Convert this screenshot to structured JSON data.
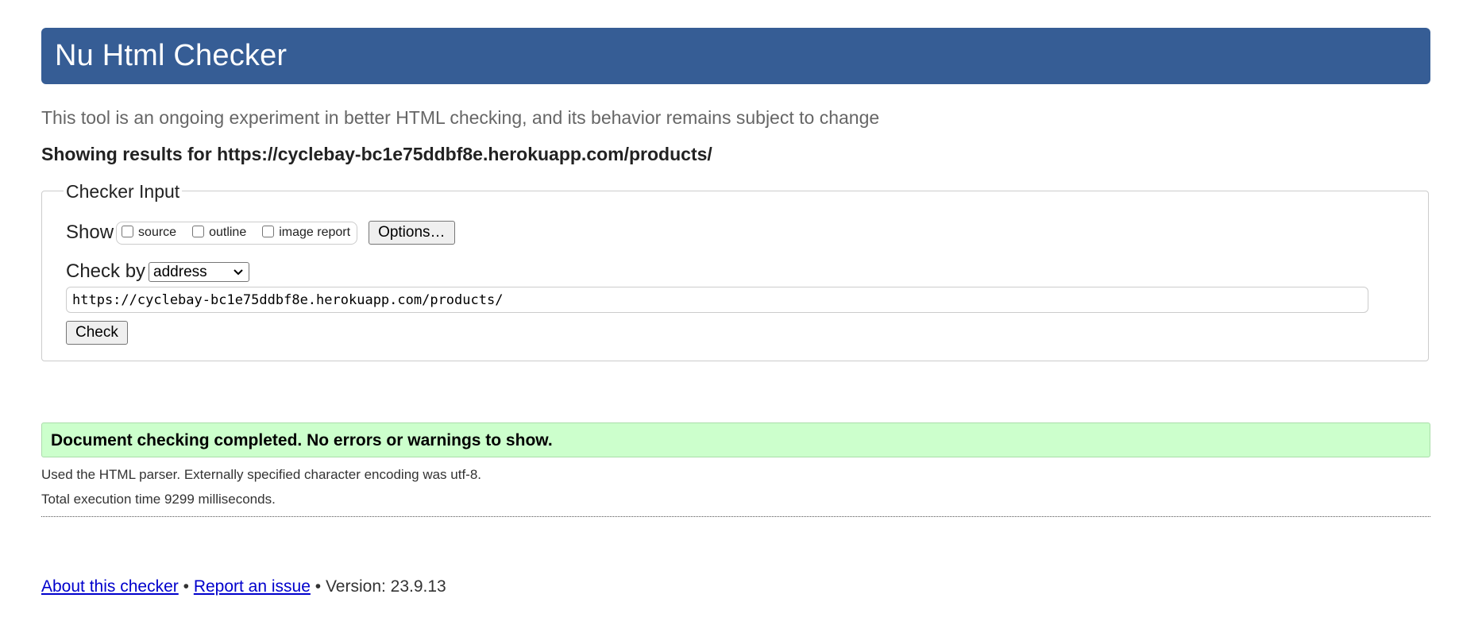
{
  "header": {
    "title": "Nu Html Checker"
  },
  "subtitle": "This tool is an ongoing experiment in better HTML checking, and its behavior remains subject to change",
  "results_for": "Showing results for https://cyclebay-bc1e75ddbf8e.herokuapp.com/products/",
  "checker_input": {
    "legend": "Checker Input",
    "show_label": "Show",
    "show_options": [
      {
        "label": "source",
        "checked": false
      },
      {
        "label": "outline",
        "checked": false
      },
      {
        "label": "image report",
        "checked": false
      }
    ],
    "options_button": "Options…",
    "check_by_label": "Check by",
    "check_by_selected": "address",
    "url_value": "https://cyclebay-bc1e75ddbf8e.herokuapp.com/products/",
    "check_button": "Check"
  },
  "result": {
    "message": "Document checking completed. No errors or warnings to show.",
    "parser_info": "Used the HTML parser. Externally specified character encoding was utf-8.",
    "execution_time": "Total execution time 9299 milliseconds."
  },
  "footer": {
    "about_link": "About this checker",
    "separator": "•",
    "report_link": "Report an issue",
    "version": "Version: 23.9.13"
  },
  "colors": {
    "header_bg": "#365d95",
    "success_bg": "#ccffcc",
    "link": "#0000cc"
  }
}
